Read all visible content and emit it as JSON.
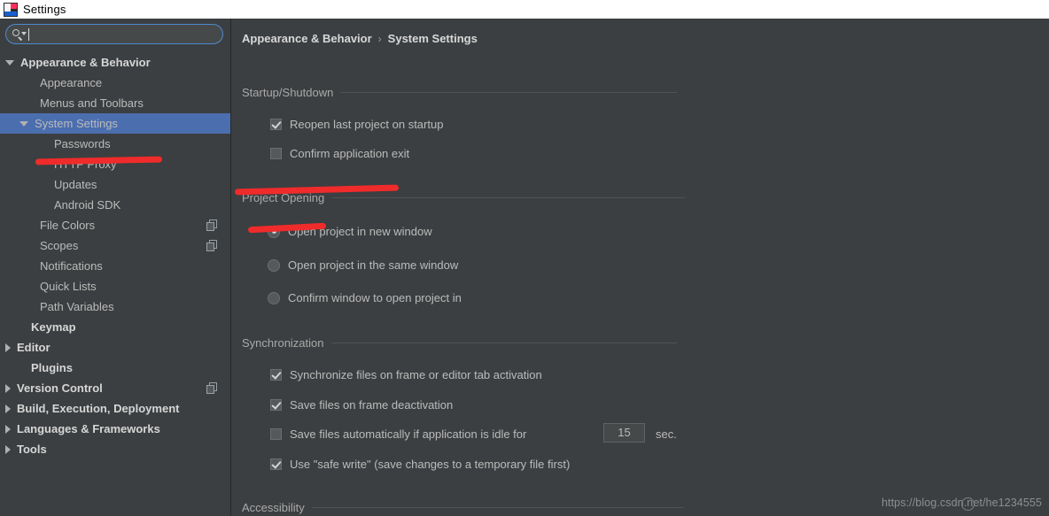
{
  "window": {
    "title": "Settings",
    "icon": "intellij-idea-icon"
  },
  "search": {
    "value": "",
    "placeholder": "",
    "icon": "search-icon"
  },
  "sidebar": {
    "items": [
      {
        "label": "Appearance & Behavior",
        "arrow": "down",
        "indent": 6,
        "bold": true,
        "selected": false,
        "copy": false
      },
      {
        "label": "Appearance",
        "arrow": "none",
        "indent": 28,
        "bold": false,
        "selected": false,
        "copy": false
      },
      {
        "label": "Menus and Toolbars",
        "arrow": "none",
        "indent": 28,
        "bold": false,
        "selected": false,
        "copy": false
      },
      {
        "label": "System Settings",
        "arrow": "down",
        "indent": 22,
        "bold": false,
        "selected": true,
        "copy": false
      },
      {
        "label": "Passwords",
        "arrow": "none",
        "indent": 44,
        "bold": false,
        "selected": false,
        "copy": false
      },
      {
        "label": "HTTP Proxy",
        "arrow": "none",
        "indent": 44,
        "bold": false,
        "selected": false,
        "copy": false
      },
      {
        "label": "Updates",
        "arrow": "none",
        "indent": 44,
        "bold": false,
        "selected": false,
        "copy": false
      },
      {
        "label": "Android SDK",
        "arrow": "none",
        "indent": 44,
        "bold": false,
        "selected": false,
        "copy": false
      },
      {
        "label": "File Colors",
        "arrow": "none",
        "indent": 28,
        "bold": false,
        "selected": false,
        "copy": true
      },
      {
        "label": "Scopes",
        "arrow": "none",
        "indent": 28,
        "bold": false,
        "selected": false,
        "copy": true
      },
      {
        "label": "Notifications",
        "arrow": "none",
        "indent": 28,
        "bold": false,
        "selected": false,
        "copy": false
      },
      {
        "label": "Quick Lists",
        "arrow": "none",
        "indent": 28,
        "bold": false,
        "selected": false,
        "copy": false
      },
      {
        "label": "Path Variables",
        "arrow": "none",
        "indent": 28,
        "bold": false,
        "selected": false,
        "copy": false
      },
      {
        "label": "Keymap",
        "arrow": "none",
        "indent": 18,
        "bold": true,
        "selected": false,
        "copy": false
      },
      {
        "label": "Editor",
        "arrow": "right",
        "indent": 6,
        "bold": true,
        "selected": false,
        "copy": false
      },
      {
        "label": "Plugins",
        "arrow": "none",
        "indent": 18,
        "bold": true,
        "selected": false,
        "copy": false
      },
      {
        "label": "Version Control",
        "arrow": "right",
        "indent": 6,
        "bold": true,
        "selected": false,
        "copy": true
      },
      {
        "label": "Build, Execution, Deployment",
        "arrow": "right",
        "indent": 6,
        "bold": true,
        "selected": false,
        "copy": false
      },
      {
        "label": "Languages & Frameworks",
        "arrow": "right",
        "indent": 6,
        "bold": true,
        "selected": false,
        "copy": false
      },
      {
        "label": "Tools",
        "arrow": "right",
        "indent": 6,
        "bold": true,
        "selected": false,
        "copy": false
      }
    ]
  },
  "content": {
    "breadcrumb": {
      "parent": "Appearance & Behavior",
      "separator": "›",
      "current": "System Settings"
    },
    "sections": [
      {
        "title": "Startup/Shutdown"
      },
      {
        "title": "Project Opening"
      },
      {
        "title": "Synchronization"
      },
      {
        "title": "Accessibility"
      }
    ],
    "startup_shutdown": {
      "options": [
        {
          "label": "Reopen last project on startup",
          "checked": true
        },
        {
          "label": "Confirm application exit",
          "checked": false
        }
      ]
    },
    "project_opening": {
      "options": [
        {
          "label": "Open project in new window",
          "selected": true
        },
        {
          "label": "Open project in the same window",
          "selected": false
        },
        {
          "label": "Confirm window to open project in",
          "selected": false
        }
      ]
    },
    "synchronization": {
      "options": [
        {
          "label": "Synchronize files on frame or editor tab activation",
          "checked": true
        },
        {
          "label": "Save files on frame deactivation",
          "checked": true
        },
        {
          "label": "Save files automatically if application is idle for",
          "checked": false
        },
        {
          "label": "Use \"safe write\" (save changes to a temporary file first)",
          "checked": true
        }
      ],
      "idle_seconds": "15",
      "idle_unit": "sec."
    }
  },
  "annotations": {
    "color": "#f02b2b",
    "marks": [
      {
        "name": "strikethrough-passwords"
      },
      {
        "name": "underline-project-opening"
      },
      {
        "name": "underline-open-new-window"
      }
    ]
  },
  "watermark": {
    "text": "https://blog.csdn.net/he1234555"
  }
}
